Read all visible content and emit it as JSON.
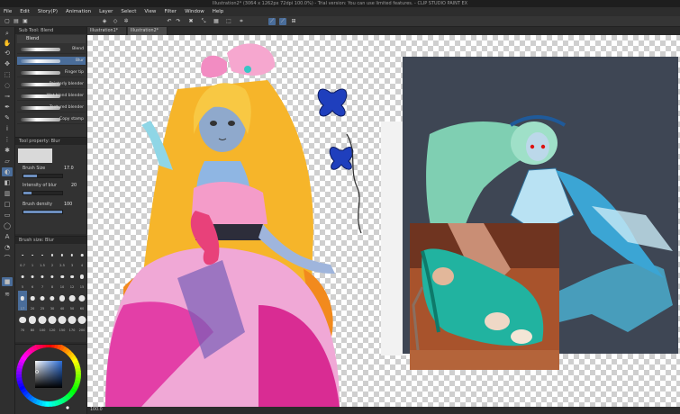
{
  "window": {
    "title": "Illustration2* (3064 x 1262px 72dpi 100.0%) - Trial version: You can use limited features. - CLIP STUDIO PAINT EX"
  },
  "menu": [
    "File",
    "Edit",
    "Story(P)",
    "Animation",
    "Layer",
    "Select",
    "View",
    "Filter",
    "Window",
    "Help"
  ],
  "sub_tool": {
    "tab_label": "Sub Tool: Blend",
    "header": "Blend",
    "brushes": [
      {
        "label": "Blend",
        "selected": false
      },
      {
        "label": "Blur",
        "selected": true
      },
      {
        "label": "Finger tip",
        "selected": false
      },
      {
        "label": "Painterly blender",
        "selected": false
      },
      {
        "label": "Wet blend blender",
        "selected": false
      },
      {
        "label": "Textured blender",
        "selected": false
      },
      {
        "label": "Copy stamp",
        "selected": false
      }
    ]
  },
  "tool_property": {
    "tab_label": "Tool property: Blur",
    "brush_size_label": "Brush Size",
    "brush_size_value": "17.0",
    "intensity_label": "Intensity of blur",
    "intensity_value": "20",
    "density_label": "Brush density",
    "density_value": "100",
    "brush_size_level": 0.34,
    "intensity_level": 0.2,
    "density_level": 1.0
  },
  "brush_size": {
    "tab_label": "Brush size: Blur",
    "sizes": [
      "0.7",
      "1",
      "1.5",
      "2",
      "2.5",
      "3",
      "4",
      "5",
      "6",
      "7",
      "8",
      "10",
      "12",
      "15",
      "17",
      "20",
      "25",
      "30",
      "40",
      "50",
      "60",
      "70",
      "80",
      "100",
      "120",
      "150",
      "170",
      "200"
    ],
    "selected": "17"
  },
  "canvas_tabs": [
    "Illustration1*",
    "Illustration2*"
  ],
  "status": {
    "zoom": "100.0"
  },
  "colors": {
    "accent": "#4a6d9a",
    "panel_bg": "#323232",
    "photo_bg": "#3e4654"
  }
}
